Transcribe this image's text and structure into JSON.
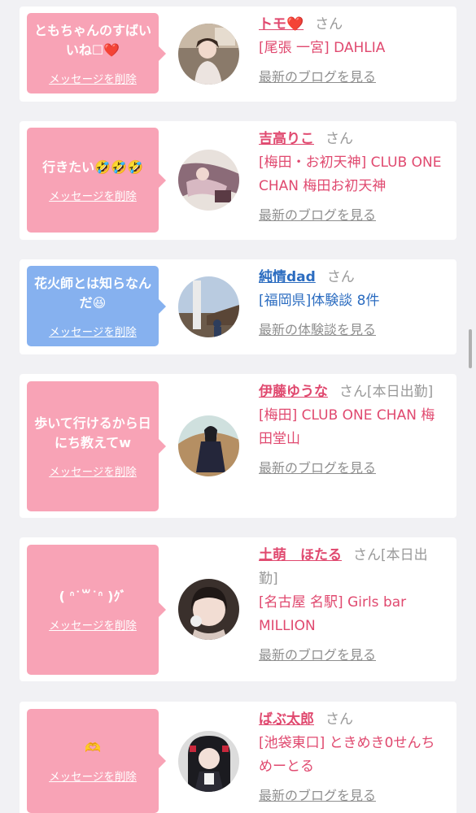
{
  "entries": [
    {
      "message": "ともちゃんのすばいいね☐❤️",
      "delete_label": "メッセージを削除",
      "bubble_color": "pink",
      "name": "トモ❤️",
      "honorific": "さん",
      "details": [
        "[尾張 一宮] DAHLIA"
      ],
      "link": "最新のブログを見る"
    },
    {
      "message": "行きたい🤣🤣🤣",
      "delete_label": "メッセージを削除",
      "bubble_color": "pink",
      "name": "吉高りこ",
      "honorific": "さん",
      "details": [
        "[梅田・お初天神] CLUB ONE CHAN 梅田お初天神"
      ],
      "link": "最新のブログを見る"
    },
    {
      "message": "花火師とは知らなんだ😆",
      "delete_label": "メッセージを削除",
      "bubble_color": "blue",
      "name": "純情dad",
      "honorific": "さん",
      "details": [
        "[福岡県]体験談 8件"
      ],
      "link": "最新の体験談を見る"
    },
    {
      "message": "歩いて行けるから日にち教えてw",
      "delete_label": "メッセージを削除",
      "bubble_color": "pink",
      "name": "伊藤ゆうな",
      "honorific": "さん[本日出勤]",
      "details": [
        "[梅田] CLUB ONE CHAN 梅田堂山"
      ],
      "link": "最新のブログを見る"
    },
    {
      "message": "( ᐢ˙꒳˙ᐢ )ｸﾞ",
      "delete_label": "メッセージを削除",
      "bubble_color": "pink",
      "name": "土萌　ほたる",
      "honorific": "さん[本日出勤]",
      "details": [
        "[名古屋 名駅] Girls bar MILLION"
      ],
      "link": "最新のブログを見る"
    },
    {
      "message": "🫶",
      "delete_label": "メッセージを削除",
      "bubble_color": "pink",
      "name": "ばぶ太郎",
      "honorific": "さん",
      "details": [
        "[池袋東口] ときめき0せんちめーとる"
      ],
      "link": "最新のブログを見る"
    }
  ],
  "colors": {
    "pink_bubble": "#f8a3b6",
    "blue_bubble": "#86b1ef",
    "name_pink": "#e0496f",
    "name_blue": "#2b6cc0",
    "muted": "#999999"
  }
}
